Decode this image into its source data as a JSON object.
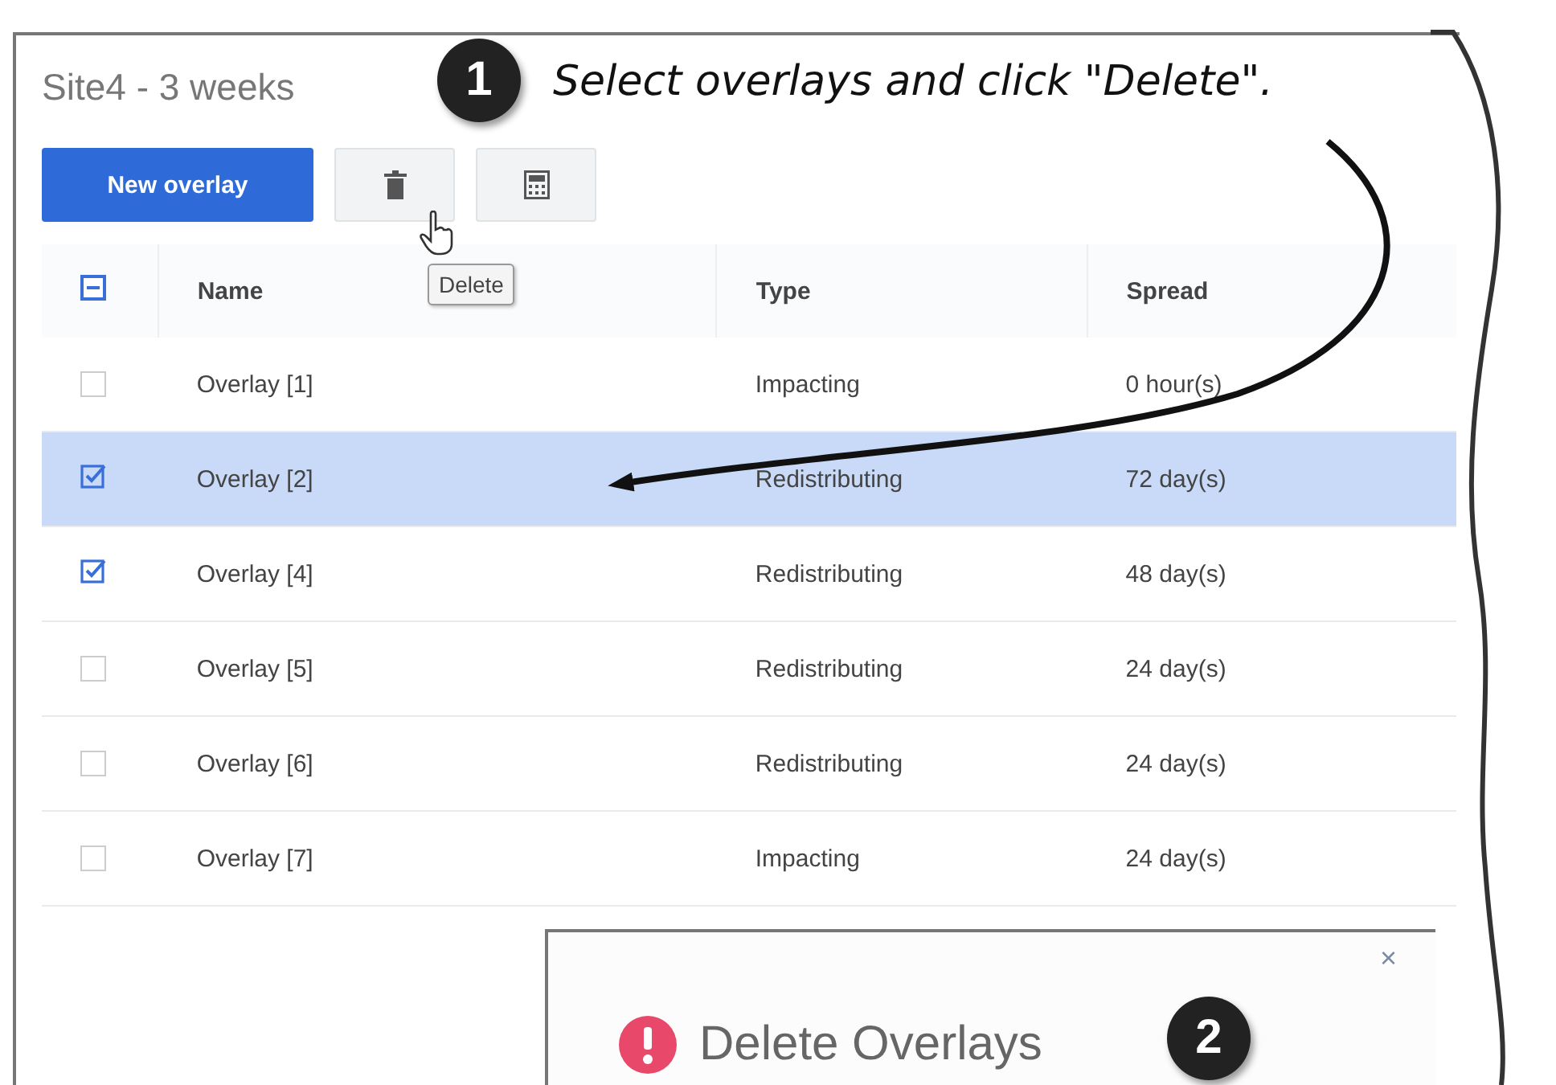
{
  "page": {
    "title": "Site4 - 3 weeks"
  },
  "toolbar": {
    "new_button": "New overlay",
    "tooltip": "Delete"
  },
  "table": {
    "header_checkbox": {
      "mixed": true
    },
    "columns": [
      "Name",
      "Type",
      "Spread"
    ],
    "rows": [
      {
        "checked": false,
        "selected": false,
        "cells": [
          "Overlay [1]",
          "Impacting",
          "0 hour(s)"
        ]
      },
      {
        "checked": true,
        "selected": true,
        "cells": [
          "Overlay [2]",
          "Redistributing",
          "72 day(s)"
        ]
      },
      {
        "checked": true,
        "selected": false,
        "cells": [
          "Overlay [4]",
          "Redistributing",
          "48 day(s)"
        ]
      },
      {
        "checked": false,
        "selected": false,
        "cells": [
          "Overlay [5]",
          "Redistributing",
          "24 day(s)"
        ]
      },
      {
        "checked": false,
        "selected": false,
        "cells": [
          "Overlay [6]",
          "Redistributing",
          "24 day(s)"
        ]
      },
      {
        "checked": false,
        "selected": false,
        "cells": [
          "Overlay [7]",
          "Impacting",
          "24 day(s)"
        ]
      }
    ]
  },
  "dialog": {
    "close": "×",
    "title": "Delete Overlays"
  },
  "annotations": [
    {
      "number": "1",
      "text": "Select overlays and click \"Delete\"."
    },
    {
      "number": "2"
    }
  ]
}
